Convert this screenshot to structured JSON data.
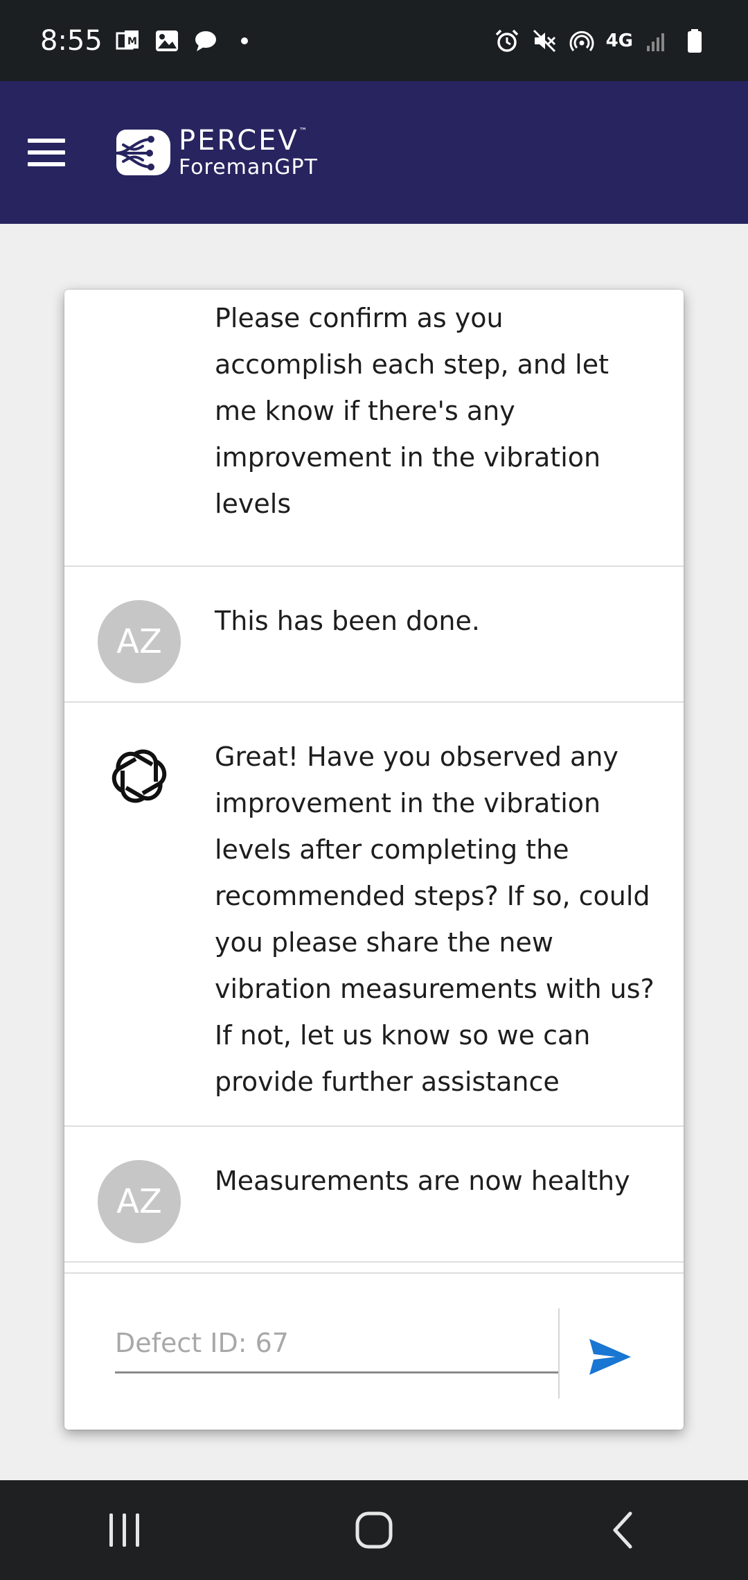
{
  "status_bar": {
    "time": "8:55",
    "network_label": "4G",
    "left_icons": [
      "ms-office-icon",
      "gallery-icon",
      "chat-bubble-icon",
      "dot-icon"
    ],
    "right_icons": [
      "alarm-icon",
      "mute-icon",
      "hotspot-icon",
      "network-4g-icon",
      "signal-icon",
      "battery-icon"
    ]
  },
  "header": {
    "brand_name": "PERCEV",
    "brand_tm": "™",
    "brand_sub": "ForemanGPT",
    "bg_color": "#27245f"
  },
  "messages": [
    {
      "sender": "assistant-partial",
      "avatar": "",
      "text": "Please confirm as you accomplish each step, and let me know if there's any improvement in the vibration levels"
    },
    {
      "sender": "user",
      "avatar": "AZ",
      "text": "This has been done."
    },
    {
      "sender": "assistant",
      "avatar": "openai-logo-icon",
      "text": "Great! Have you observed any improvement in the vibration levels after completing the recommended steps? If so, could you please share the new vibration measurements with us? If not, let us know so we can provide further assistance"
    },
    {
      "sender": "user",
      "avatar": "AZ",
      "text": "Measurements are now healthy"
    }
  ],
  "input": {
    "placeholder": "Defect ID: 67",
    "value": ""
  },
  "colors": {
    "send_accent": "#1976d2",
    "avatar_bg": "#c6c6c6"
  },
  "nav": [
    "recents-icon",
    "home-icon",
    "back-icon"
  ]
}
